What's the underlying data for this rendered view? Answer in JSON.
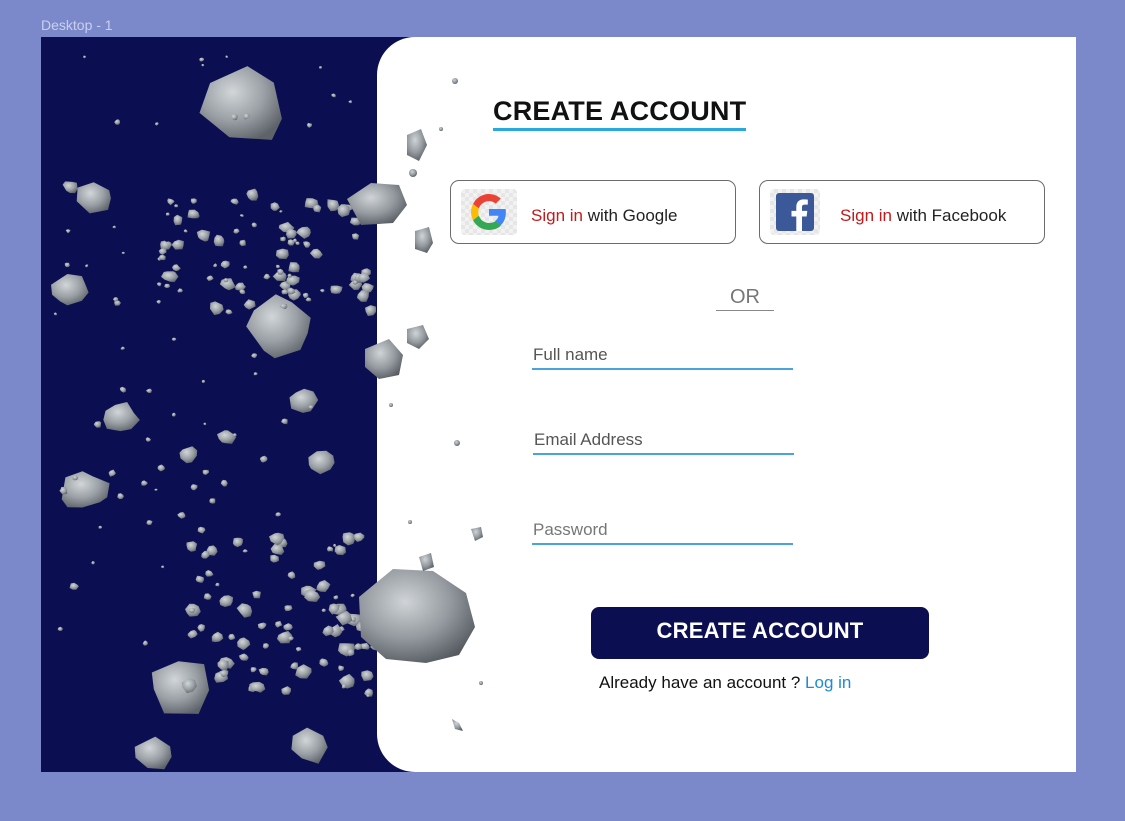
{
  "frame": {
    "label": "Desktop - 1"
  },
  "form": {
    "title": "CREATE ACCOUNT",
    "google": {
      "prefix": "Sign in",
      "suffix": " with Google",
      "icon": "google-logo-icon"
    },
    "facebook": {
      "prefix": "Sign in",
      "suffix": " with Facebook",
      "icon": "facebook-logo-icon"
    },
    "divider_label": "OR",
    "fields": {
      "full_name_placeholder": "Full name",
      "email_placeholder": "Email Address",
      "password_placeholder": "Password"
    },
    "submit_label": "CREATE ACCOUNT",
    "login_prompt": "Already have an account ? ",
    "login_link": "Log in"
  },
  "colors": {
    "page_background": "#7b89cb",
    "space_navy": "#0b0f52",
    "title_underline": "#29a8e0",
    "sign_in_red": "#c11a1a",
    "field_underline": "#49a3dd",
    "link_blue": "#1e8bd6"
  }
}
